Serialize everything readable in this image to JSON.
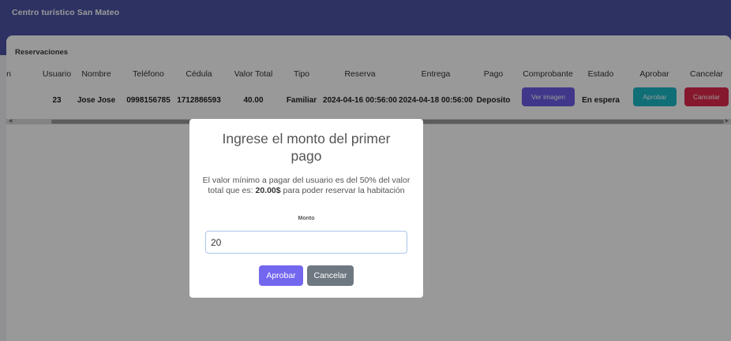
{
  "app": {
    "title": "Centro turístico San Mateo"
  },
  "section": {
    "title": "Reservaciones"
  },
  "table": {
    "headers": {
      "cut": "n",
      "usuario": "Usuario",
      "nombre": "Nombre",
      "telefono": "Teléfono",
      "cedula": "Cédula",
      "valor_total": "Valor Total",
      "tipo": "Tipo",
      "reserva": "Reserva",
      "entrega": "Entrega",
      "pago": "Pago",
      "comprobante": "Comprobante",
      "estado": "Estado",
      "aprobar": "Aprobar",
      "cancelar": "Cancelar"
    },
    "row": {
      "usuario": "23",
      "nombre": "Jose Jose",
      "telefono": "0998156785",
      "cedula": "1712886593",
      "valor_total": "40.00",
      "tipo": "Familiar",
      "reserva": "2024-04-16 00:56:00",
      "entrega": "2024-04-18 00:56:00",
      "pago": "Deposito",
      "comprobante_button": "Ver imagen",
      "estado": "En espera",
      "aprobar_button": "Aprobar",
      "cancelar_button": "Cancelar"
    }
  },
  "modal": {
    "title": "Ingrese el monto del primer pago",
    "text_before": "El valor mínimo a pagar del usuario es del 50% del valor total que es:",
    "min_amount": "20.00$",
    "text_after": "para poder reservar la habitación",
    "field_label": "Monto",
    "input_value": "20",
    "approve_button": "Aprobar",
    "cancel_button": "Cancelar"
  },
  "colors": {
    "header_bar": "#4b54a6",
    "view_button": "#6c5ce7",
    "approve_button": "#1bb7c6",
    "cancel_button": "#e0294e",
    "modal_approve": "#7367f0",
    "modal_cancel": "#6e7881"
  }
}
